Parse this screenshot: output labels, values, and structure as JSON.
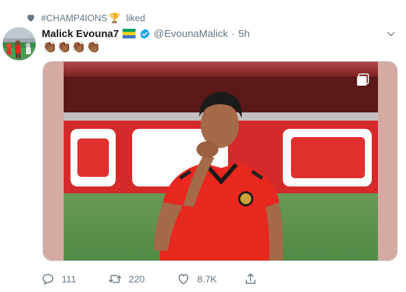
{
  "context": {
    "text": "#CHAMP4IONS",
    "trophy_emoji": "🏆",
    "action": "liked"
  },
  "tweet": {
    "display_name": "Malick Evouna7",
    "flag_colors": [
      "#009e60",
      "#fcd116",
      "#3a75c4"
    ],
    "handle": "@EvounaMalick",
    "separator": "·",
    "time": "5h",
    "text": "👏🏾👏🏾👏🏾👏🏾",
    "media_icon": "gallery-icon"
  },
  "actions": {
    "replies": "111",
    "retweets": "220",
    "likes": "8.7K"
  },
  "colors": {
    "secondary_text": "#657786",
    "verified_blue": "#1da1f2",
    "jersey_red": "#e8271e",
    "stadium_red": "#c81e1e"
  }
}
